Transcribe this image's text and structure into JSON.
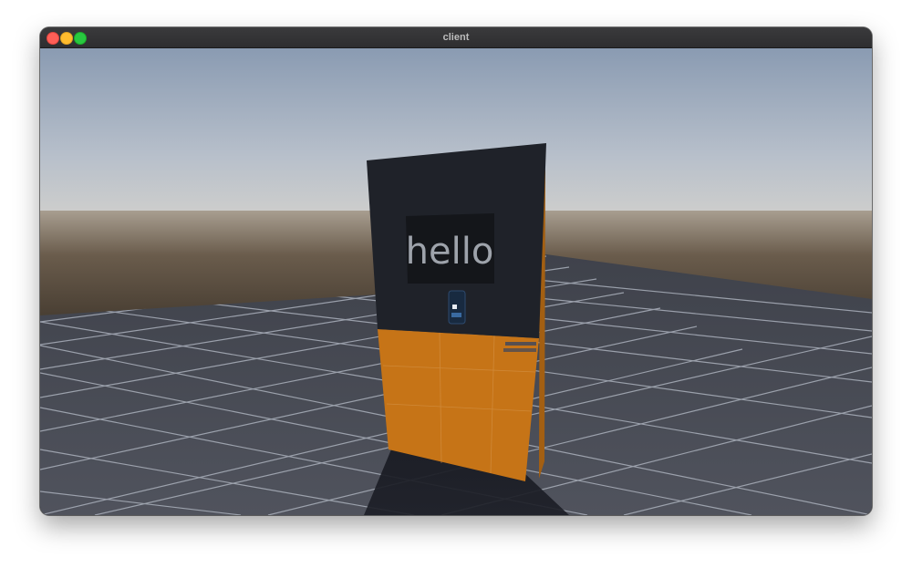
{
  "window": {
    "title": "client"
  },
  "scene": {
    "panel_text": "hello",
    "colors": {
      "sky_top": "#8a9bb2",
      "sky_horizon": "#d4d2cc",
      "ground": "#4b4e58",
      "grid": "#9aa0ac",
      "panel_dark": "#1f2229",
      "panel_screen": "#14161a",
      "panel_orange": "#c67417"
    }
  }
}
